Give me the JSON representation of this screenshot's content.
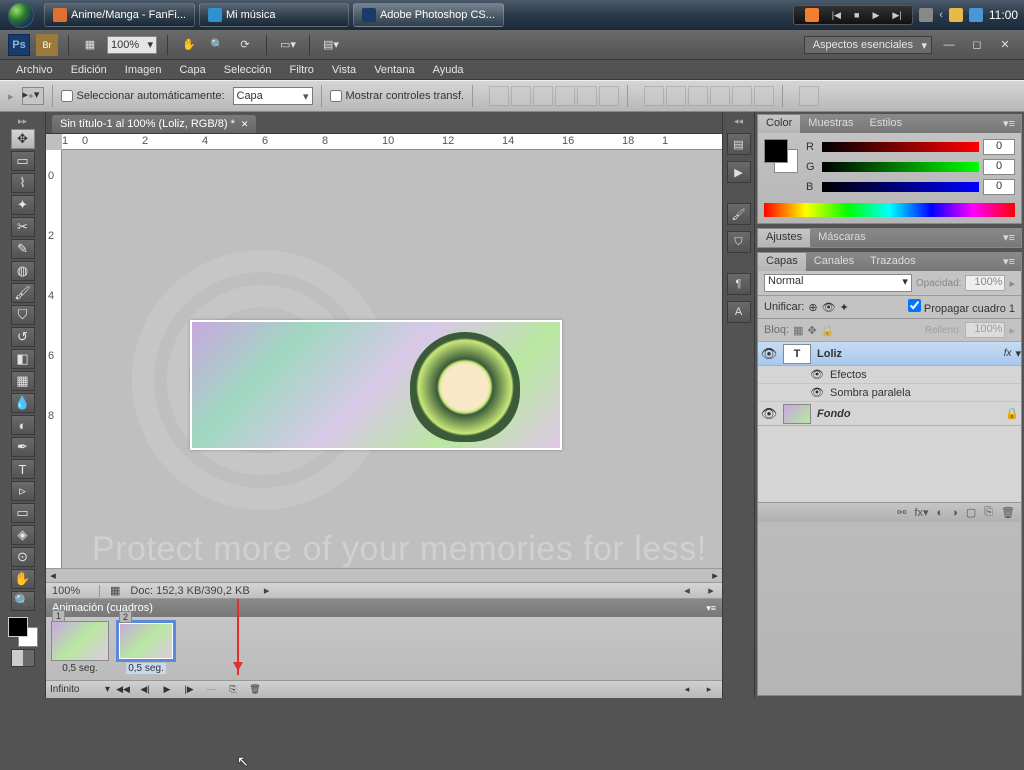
{
  "taskbar": {
    "items": [
      {
        "label": "Anime/Manga - FanFi...",
        "icon": "#e07030"
      },
      {
        "label": "Mi música",
        "icon": "#3090d0"
      },
      {
        "label": "Adobe Photoshop CS...",
        "icon": "#1a3a6a"
      }
    ],
    "clock": "11:00"
  },
  "app_bar": {
    "zoom": "100%",
    "workspace": "Aspectos esenciales"
  },
  "menu": [
    "Archivo",
    "Edición",
    "Imagen",
    "Capa",
    "Selección",
    "Filtro",
    "Vista",
    "Ventana",
    "Ayuda"
  ],
  "options": {
    "auto_select": "Seleccionar automáticamente:",
    "auto_target": "Capa",
    "show_transform": "Mostrar controles transf."
  },
  "document": {
    "tab": "Sin título-1 al 100% (Loliz, RGB/8) *",
    "status_zoom": "100%",
    "status_doc": "Doc: 152,3 KB/390,2 KB"
  },
  "animation": {
    "title": "Animación (cuadros)",
    "frames": [
      {
        "num": "1",
        "delay": "0,5 seg."
      },
      {
        "num": "2",
        "delay": "0,5 seg."
      }
    ],
    "loop": "Infinito"
  },
  "color_panel": {
    "tabs": [
      "Color",
      "Muestras",
      "Estilos"
    ],
    "r": "0",
    "g": "0",
    "b": "0"
  },
  "adjust_panel": {
    "tabs": [
      "Ajustes",
      "Máscaras"
    ]
  },
  "layers_panel": {
    "tabs": [
      "Capas",
      "Canales",
      "Trazados"
    ],
    "blend": "Normal",
    "opacity_lbl": "Opacidad:",
    "opacity": "100%",
    "unify": "Unificar:",
    "propagate": "Propagar cuadro 1",
    "lock_lbl": "Bloq:",
    "fill_lbl": "Relleno:",
    "fill": "100%",
    "layers": [
      {
        "name": "Loliz",
        "type": "T",
        "fx": "fx"
      },
      {
        "name": "Fondo",
        "type": "bg"
      }
    ],
    "effects": "Efectos",
    "effect1": "Sombra paralela"
  },
  "watermark": "Protect more of your memories for less!"
}
